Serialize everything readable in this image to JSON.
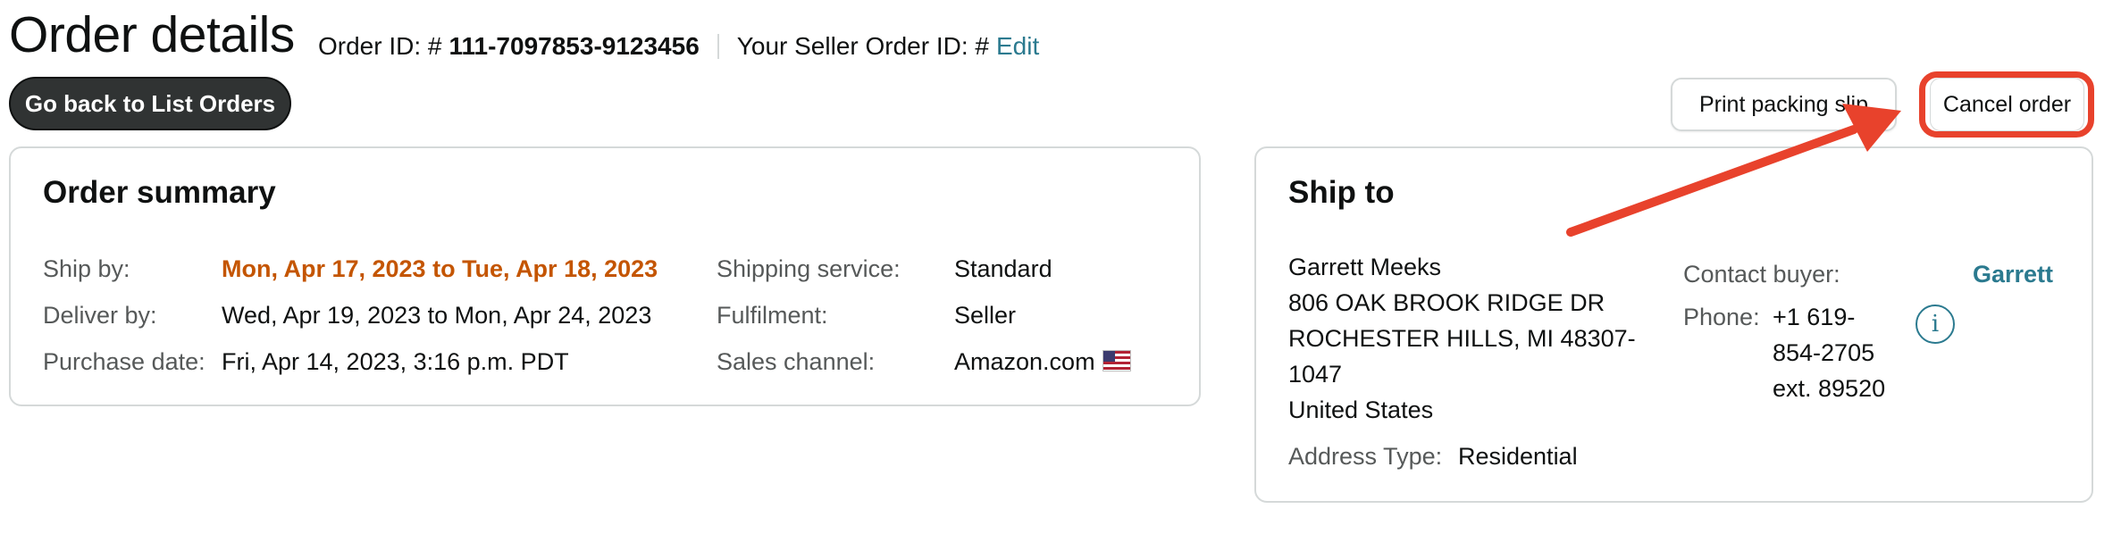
{
  "header": {
    "title": "Order details",
    "order_id_label": "Order ID: #",
    "order_id": "111-7097853-9123456",
    "seller_order_id_label": "Your Seller Order ID: #",
    "edit_link": "Edit"
  },
  "actions": {
    "back_button": "Go back to List Orders",
    "print_button": "Print packing slip",
    "cancel_button": "Cancel order"
  },
  "annotation": {
    "highlight_color": "#e8422c"
  },
  "order_summary": {
    "title": "Order summary",
    "ship_by_label": "Ship by:",
    "ship_by_value": "Mon, Apr 17, 2023 to Tue, Apr 18, 2023",
    "deliver_by_label": "Deliver by:",
    "deliver_by_value": "Wed, Apr 19, 2023 to Mon, Apr 24, 2023",
    "purchase_date_label": "Purchase date:",
    "purchase_date_value": "Fri, Apr 14, 2023, 3:16 p.m. PDT",
    "shipping_service_label": "Shipping service:",
    "shipping_service_value": "Standard",
    "fulfilment_label": "Fulfilment:",
    "fulfilment_value": "Seller",
    "sales_channel_label": "Sales channel:",
    "sales_channel_value": "Amazon.com",
    "sales_channel_icon": "us-flag-icon"
  },
  "ship_to": {
    "title": "Ship to",
    "name": "Garrett Meeks",
    "address_line1": "806 OAK BROOK RIDGE DR",
    "address_line2": "ROCHESTER HILLS, MI 48307-",
    "address_line3": "1047",
    "country": "United States",
    "address_type_label": "Address Type:",
    "address_type_value": "Residential",
    "contact_buyer_label": "Contact buyer:",
    "contact_buyer_link": "Garrett",
    "phone_label": "Phone:",
    "phone_line1": "+1 619-",
    "phone_line2": "854-2705",
    "phone_line3": "ext. 89520",
    "info_icon": "i"
  },
  "colors": {
    "ship_by_accent": "#c45500",
    "link": "#2b7a8f",
    "annotation": "#e8422c"
  }
}
